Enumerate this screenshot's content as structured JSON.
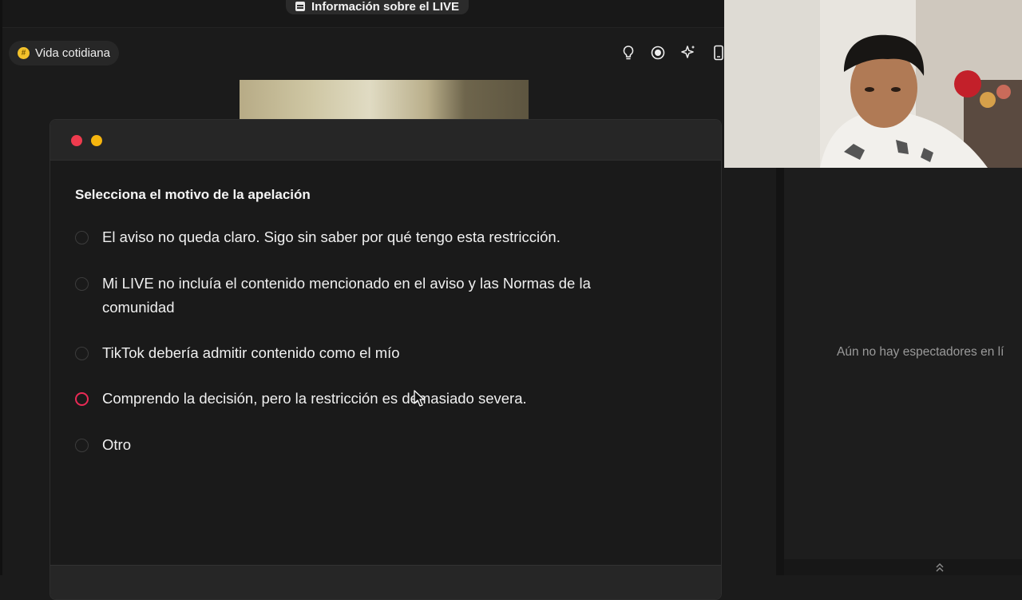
{
  "header": {
    "live_info_label": "Información sobre el LIVE"
  },
  "chip": {
    "label": "Vida cotidiana",
    "icon": "hash-icon"
  },
  "toolbar": {
    "icons": [
      "lightbulb-icon",
      "record-icon",
      "sparkle-icon",
      "phone-icon"
    ]
  },
  "modal": {
    "title": "Selecciona el motivo de la apelación",
    "options": [
      {
        "label": "El aviso no queda claro. Sigo sin saber por qué tengo esta restricción.",
        "selected": false
      },
      {
        "label": "Mi LIVE no incluía el contenido mencionado en el aviso y las Normas de la comunidad",
        "selected": false
      },
      {
        "label": "TikTok debería admitir contenido como el mío",
        "selected": false
      },
      {
        "label": "Comprendo la decisión, pero la restricción es demasiado severa.",
        "selected": true
      },
      {
        "label": "Otro",
        "selected": false
      }
    ]
  },
  "viewers": {
    "empty_text": "Aún no hay espectadores en lí"
  },
  "colors": {
    "accent": "#ea2a55",
    "close_dot": "#ee3b4e",
    "minimize_dot": "#f5b50e",
    "chip_icon": "#f3c22b"
  }
}
